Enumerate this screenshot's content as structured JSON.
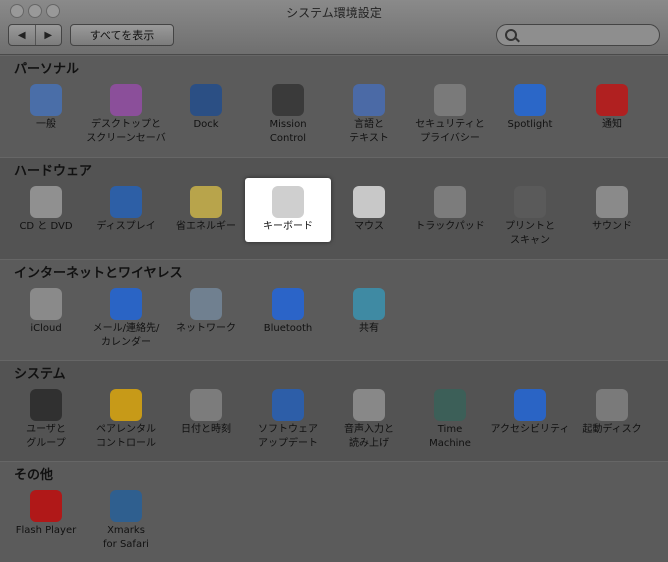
{
  "window": {
    "title": "システム環境設定"
  },
  "toolbar": {
    "back_label": "◀",
    "forward_label": "▶",
    "show_all_label": "すべてを表示",
    "search_placeholder": ""
  },
  "sections": [
    {
      "title": "パーソナル",
      "items": [
        {
          "label": "一般",
          "icon": "general-icon",
          "color": "#4a6ea8"
        },
        {
          "label": "デスクトップと\nスクリーンセーバ",
          "icon": "desktop-screensaver-icon",
          "color": "#8b4f9a"
        },
        {
          "label": "Dock",
          "icon": "dock-icon",
          "color": "#2b4f84"
        },
        {
          "label": "Mission\nControl",
          "icon": "mission-control-icon",
          "color": "#3a3a3a"
        },
        {
          "label": "言語と\nテキスト",
          "icon": "language-text-icon",
          "color": "#4b6aa6"
        },
        {
          "label": "セキュリティと\nプライバシー",
          "icon": "security-privacy-icon",
          "color": "#7a7a7a"
        },
        {
          "label": "Spotlight",
          "icon": "spotlight-icon",
          "color": "#2b67c8"
        },
        {
          "label": "通知",
          "icon": "notifications-icon",
          "color": "#b02020"
        }
      ]
    },
    {
      "title": "ハードウェア",
      "items": [
        {
          "label": "CD と DVD",
          "icon": "cd-dvd-icon",
          "color": "#909090"
        },
        {
          "label": "ディスプレイ",
          "icon": "displays-icon",
          "color": "#2d5fa6"
        },
        {
          "label": "省エネルギー",
          "icon": "energy-saver-icon",
          "color": "#b8a44b"
        },
        {
          "label": "キーボード",
          "icon": "keyboard-icon",
          "color": "#cfcfcf",
          "selected": true
        },
        {
          "label": "マウス",
          "icon": "mouse-icon",
          "color": "#c8c8c8"
        },
        {
          "label": "トラックパッド",
          "icon": "trackpad-icon",
          "color": "#7c7c7c"
        },
        {
          "label": "プリントと\nスキャン",
          "icon": "print-scan-icon",
          "color": "#5a5a5a"
        },
        {
          "label": "サウンド",
          "icon": "sound-icon",
          "color": "#8a8a8a"
        }
      ]
    },
    {
      "title": "インターネットとワイヤレス",
      "items": [
        {
          "label": "iCloud",
          "icon": "icloud-icon",
          "color": "#8a8a8a"
        },
        {
          "label": "メール/連絡先/\nカレンダー",
          "icon": "mail-contacts-calendar-icon",
          "color": "#2a64c5"
        },
        {
          "label": "ネットワーク",
          "icon": "network-icon",
          "color": "#708090"
        },
        {
          "label": "Bluetooth",
          "icon": "bluetooth-icon",
          "color": "#2b64c8"
        },
        {
          "label": "共有",
          "icon": "sharing-icon",
          "color": "#3f8aa3"
        }
      ]
    },
    {
      "title": "システム",
      "items": [
        {
          "label": "ユーザと\nグループ",
          "icon": "users-groups-icon",
          "color": "#303030"
        },
        {
          "label": "ペアレンタル\nコントロール",
          "icon": "parental-controls-icon",
          "color": "#c79a18"
        },
        {
          "label": "日付と時刻",
          "icon": "date-time-icon",
          "color": "#7c7c7c"
        },
        {
          "label": "ソフトウェア\nアップデート",
          "icon": "software-update-icon",
          "color": "#2d5ea8"
        },
        {
          "label": "音声入力と\n読み上げ",
          "icon": "dictation-speech-icon",
          "color": "#888888"
        },
        {
          "label": "Time\nMachine",
          "icon": "time-machine-icon",
          "color": "#3c5f58"
        },
        {
          "label": "アクセシビリティ",
          "icon": "accessibility-icon",
          "color": "#2a64c5"
        },
        {
          "label": "起動ディスク",
          "icon": "startup-disk-icon",
          "color": "#7a7a7a"
        }
      ]
    },
    {
      "title": "その他",
      "items": [
        {
          "label": "Flash Player",
          "icon": "flash-player-icon",
          "color": "#b01818"
        },
        {
          "label": "Xmarks\nfor Safari",
          "icon": "xmarks-icon",
          "color": "#2f5f8f"
        }
      ]
    }
  ]
}
